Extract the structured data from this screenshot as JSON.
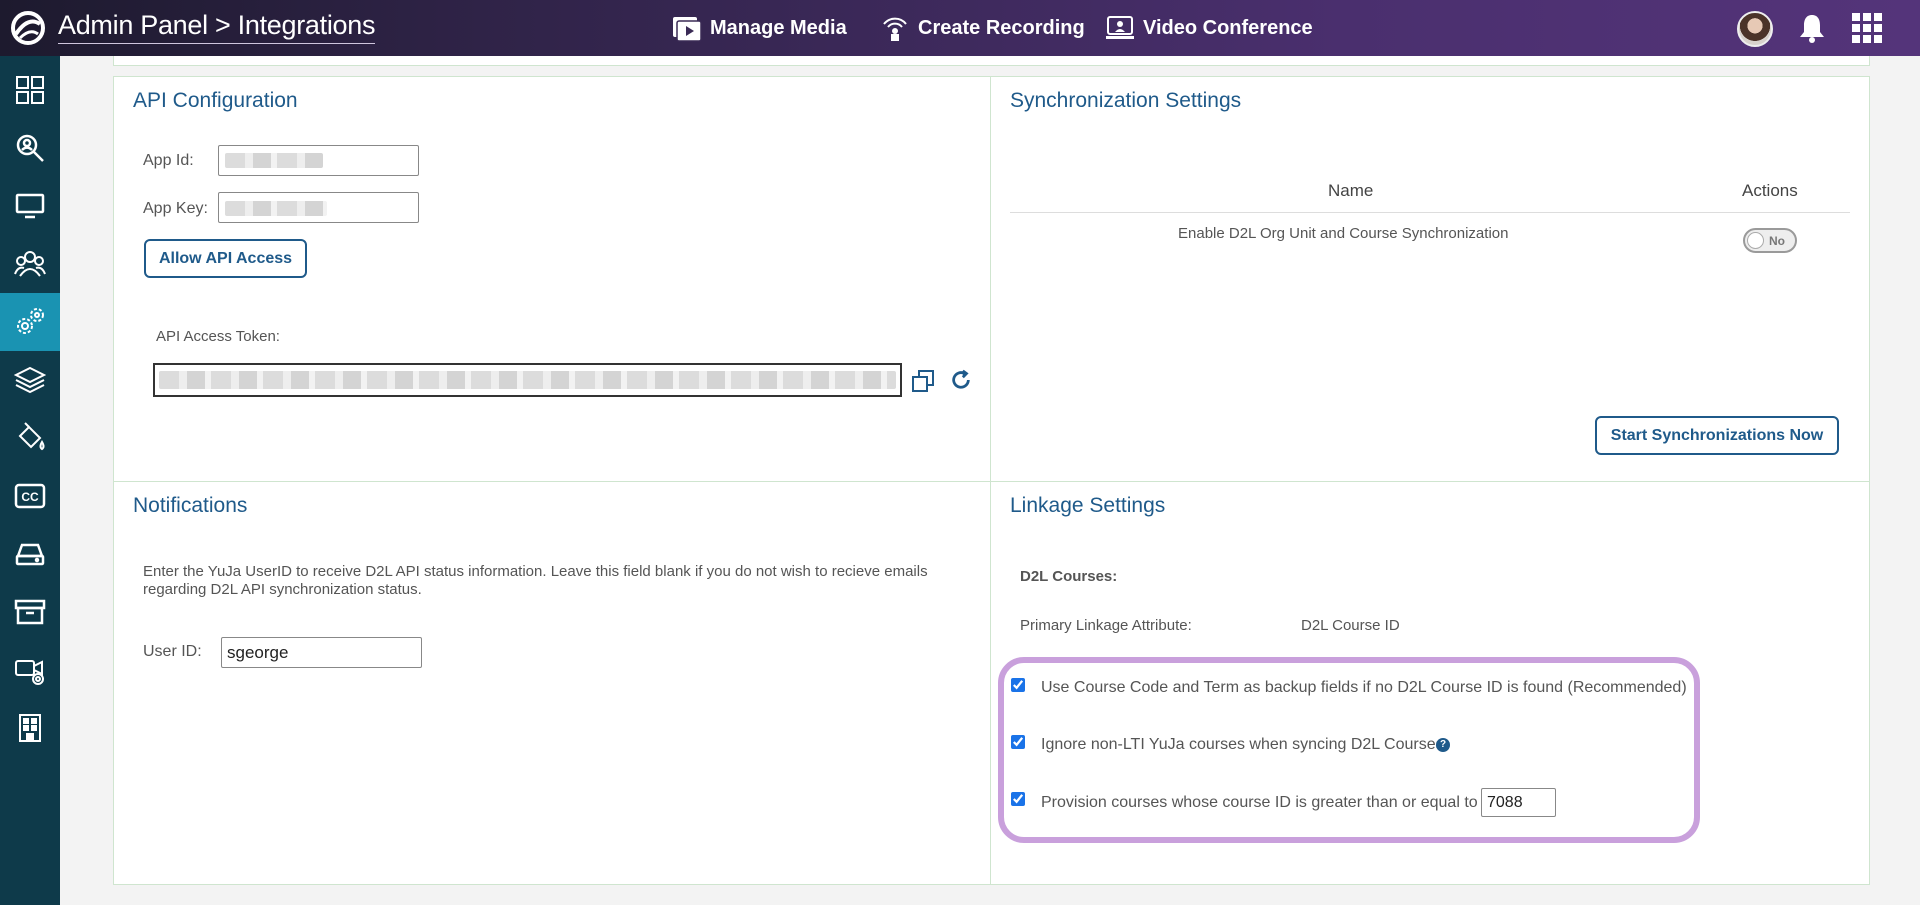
{
  "header": {
    "breadcrumb_root": "Admin Panel",
    "breadcrumb_sep": ">",
    "breadcrumb_current": "Integrations",
    "nav": [
      {
        "label": "Manage Media",
        "icon": "media-icon"
      },
      {
        "label": "Create Recording",
        "icon": "broadcast-icon"
      },
      {
        "label": "Video Conference",
        "icon": "video-conference-icon"
      }
    ]
  },
  "sidebar": {
    "items": [
      {
        "icon": "dashboard-icon"
      },
      {
        "icon": "search-analytics-icon"
      },
      {
        "icon": "monitor-icon"
      },
      {
        "icon": "users-icon"
      },
      {
        "icon": "settings-gears-icon",
        "active": true
      },
      {
        "icon": "layers-icon"
      },
      {
        "icon": "paint-bucket-icon"
      },
      {
        "icon": "closed-caption-icon"
      },
      {
        "icon": "storage-drive-icon"
      },
      {
        "icon": "archive-icon"
      },
      {
        "icon": "video-device-icon"
      },
      {
        "icon": "building-icon"
      }
    ]
  },
  "api_config": {
    "title": "API Configuration",
    "app_id_label": "App Id:",
    "app_key_label": "App Key:",
    "allow_button": "Allow API Access",
    "token_label": "API Access Token:"
  },
  "sync": {
    "title": "Synchronization Settings",
    "col_name": "Name",
    "col_actions": "Actions",
    "row_name": "Enable D2L Org Unit and Course Synchronization",
    "toggle_text": "No",
    "start_button": "Start Synchronizations Now"
  },
  "notifications": {
    "title": "Notifications",
    "description": "Enter the YuJa UserID to receive D2L API status information. Leave this field blank if you do not wish to recieve emails regarding D2L API synchronization status.",
    "user_id_label": "User ID:",
    "user_id_value": "sgeorge"
  },
  "linkage": {
    "title": "Linkage Settings",
    "courses_label": "D2L Courses:",
    "primary_label": "Primary Linkage Attribute:",
    "primary_value": "D2L Course ID",
    "options": [
      {
        "label": "Use Course Code and Term as backup fields if no D2L Course ID is found (Recommended)",
        "checked": true
      },
      {
        "label": "Ignore non-LTI YuJa courses when syncing D2L Courses",
        "checked": true
      },
      {
        "label": "Provision courses whose course ID is greater than or equal to",
        "checked": true
      }
    ],
    "help_icon": "?",
    "course_id_threshold": "7088"
  },
  "colors": {
    "accent": "#1f5a8a",
    "sidebar": "#0e3a4a",
    "sidebar_active": "#1a93b2",
    "highlight": "#c9a0dc"
  }
}
